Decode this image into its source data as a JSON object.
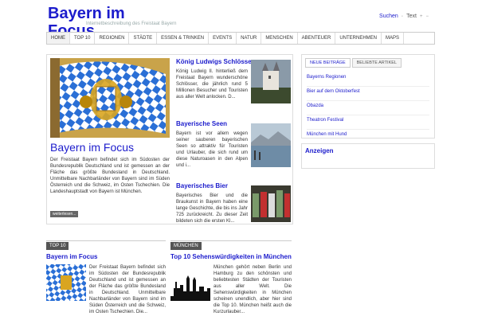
{
  "header": {
    "logo_text": "Bayern im Focus",
    "tagline": "Internetbeschreibung des Freistaat Bayern",
    "search_label": "Suchen",
    "text_label": "Text"
  },
  "nav": {
    "items": [
      "HOME",
      "TOP 10",
      "REGIONEN",
      "STÄDTE",
      "ESSEN & TRINKEN",
      "EVENTS",
      "NATUR",
      "MENSCHEN",
      "ABENTEUER",
      "UNTERNEHMEN",
      "MAPS"
    ]
  },
  "featured": {
    "title": "Bayern im Focus",
    "text": "Der Freistaat Bayern befindet sich im Südosten der Bundesrepublik Deutschland und ist gemessen an der Fläche das größte Bundesland in Deutschland. Unmittelbare Nachbarländer von Bayern sind im Süden Österreich und die Schweiz, im Osten Tschechien. Die Landeshauptstadt von Bayern ist München.",
    "more_label": "weiterlesen..."
  },
  "side_articles": [
    {
      "title": "König Ludwigs Schlösser",
      "text": "König Ludwig II. hinterließ dem Freistaat Bayern wunderschöne Schlösser, die jährlich rund 5 Millionen Besucher und Touristen aus aller Welt anlocken. D..."
    },
    {
      "title": "Bayerische Seen",
      "text": "Bayern ist vor allem wegen seiner sauberen bayerischen Seen so attraktiv für Touristen und Urlauber, die sich rund um diese Naturoasen in den Alpen und i..."
    },
    {
      "title": "Bayerisches Bier",
      "text": "Bayerisches Bier und die Braukunst in Bayern haben eine lange Geschichte, die bis ins Jahr 725 zurückreicht. Zu dieser Zeit bildeten sich die ersten Kl..."
    }
  ],
  "sections": [
    {
      "tag": "TOP 10",
      "title": "Bayern im Focus",
      "text": "Der Freistaat Bayern befindet sich im Südosten der Bundesrepublik Deutschland und ist gemessen an der Fläche das größte Bundesland in Deutschland. Unmittelbare Nachbarländer von Bayern sind im Süden Österreich und die Schweiz, im Osten Tschechien. Die..."
    },
    {
      "tag": "MÜNCHEN",
      "title": "Top 10 Sehenswürdigkeiten in München",
      "text": "München gehört neben Berlin und Hamburg zu den schönsten und beliebtesten Städten der Touristen aus aller Welt. Die Sehenswürdigkeiten in München scheinen unendlich, aber hier sind die Top 10. München heißt auch die Kurzurlauber..."
    }
  ],
  "sidebar": {
    "tabs": [
      "NEUE BEITRÄGE",
      "BELIEBTE ARTIKEL"
    ],
    "links": [
      "Bayerns Regionen",
      "Bier auf dem Oktoberfest",
      "Obazda",
      "Theatron Festival",
      "München mit Hund"
    ],
    "ads_title": "Anzeigen"
  },
  "colors": {
    "accent": "#1c1ccc",
    "bavaria_blue": "#2a6fd6"
  }
}
